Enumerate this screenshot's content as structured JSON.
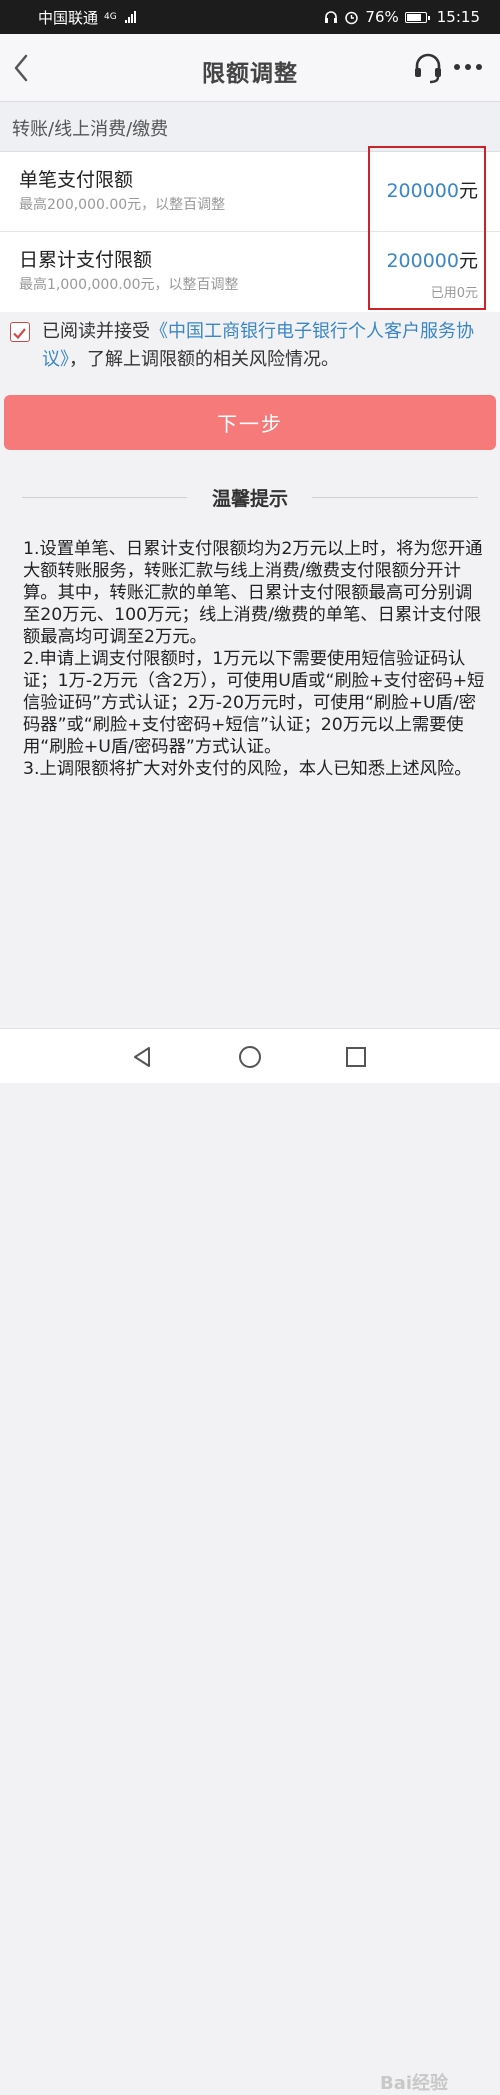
{
  "status_bar": {
    "carrier": "中国联通",
    "network": "4G",
    "battery": "76%",
    "time": "15:15"
  },
  "nav": {
    "title": "限额调整",
    "icons": [
      "back-icon",
      "headset-icon",
      "more-icon"
    ]
  },
  "section": {
    "title": "转账/线上消费/缴费"
  },
  "limits": [
    {
      "title": "单笔支付限额",
      "subtitle": "最高200,000.00元，以整百调整",
      "value": "200000",
      "unit": "元"
    },
    {
      "title": "日累计支付限额",
      "subtitle": "最高1,000,000.00元，以整百调整",
      "value": "200000",
      "unit": "元",
      "used": "已用0元"
    }
  ],
  "agreement": {
    "checked": true,
    "prefix": "已阅读并接受",
    "link": "《中国工商银行电子银行个人客户服务协议》",
    "suffix": "，了解上调限额的相关风险情况。"
  },
  "next_button": "下一步",
  "tips": {
    "title": "温馨提示",
    "items": [
      "1.设置单笔、日累计支付限额均为2万元以上时，将为您开通大额转账服务，转账汇款与线上消费/缴费支付限额分开计算。其中，转账汇款的单笔、日累计支付限额最高可分别调至20万元、100万元；线上消费/缴费的单笔、日累计支付限额最高均可调至2万元。",
      "2.申请上调支付限额时，1万元以下需要使用短信验证码认证；1万-2万元（含2万），可使用U盾或“刷脸+支付密码+短信验证码”方式认证；2万-20万元时，可使用“刷脸+U盾/密码器”或“刷脸+支付密码+短信”认证；20万元以上需要使用“刷脸+U盾/密码器”方式认证。",
      "3.上调限额将扩大对外支付的风险，本人已知悉上述风险。"
    ]
  },
  "watermark": "Bai经验",
  "colors": {
    "accent_blue": "#3a86c9",
    "button_red": "#f67a7a",
    "highlight_red": "#cc2229"
  }
}
